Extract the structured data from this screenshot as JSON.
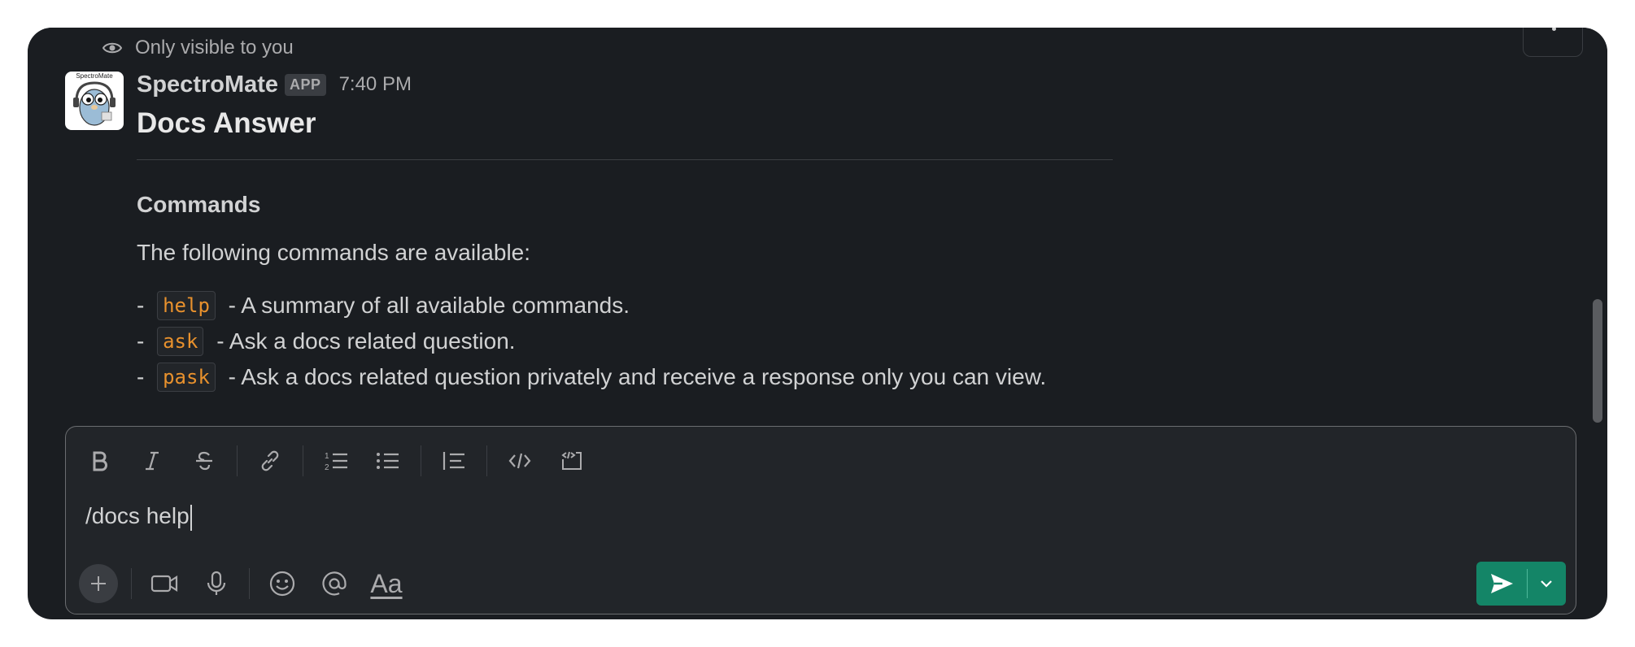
{
  "visibility_note": "Only visible to you",
  "message": {
    "sender": "SpectroMate",
    "badge": "APP",
    "time": "7:40 PM",
    "avatar_text": "SpectroMate",
    "title": "Docs Answer",
    "heading": "Commands",
    "intro": "The following commands are available:",
    "commands": [
      {
        "prefix": "- ",
        "name": "help",
        "desc": " - A summary of all available commands."
      },
      {
        "prefix": "- ",
        "name": "ask",
        "desc": " - Ask a docs related question."
      },
      {
        "prefix": "- ",
        "name": "pask",
        "desc": " - Ask a docs related question privately and receive a response only you can view."
      }
    ]
  },
  "composer": {
    "text": "/docs help",
    "formatting_buttons": [
      "bold-icon",
      "italic-icon",
      "strikethrough-icon",
      "link-icon",
      "ordered-list-icon",
      "bullet-list-icon",
      "blockquote-icon",
      "code-icon",
      "code-block-icon"
    ],
    "bottom_buttons": [
      "plus-icon",
      "video-icon",
      "microphone-icon",
      "emoji-icon",
      "mention-icon",
      "format-text-icon"
    ],
    "format_label": "Aa",
    "send_icon": "send-icon"
  },
  "colors": {
    "background": "#1a1d21",
    "text": "#d1d2d3",
    "code": "#e8912d",
    "send": "#148567"
  }
}
